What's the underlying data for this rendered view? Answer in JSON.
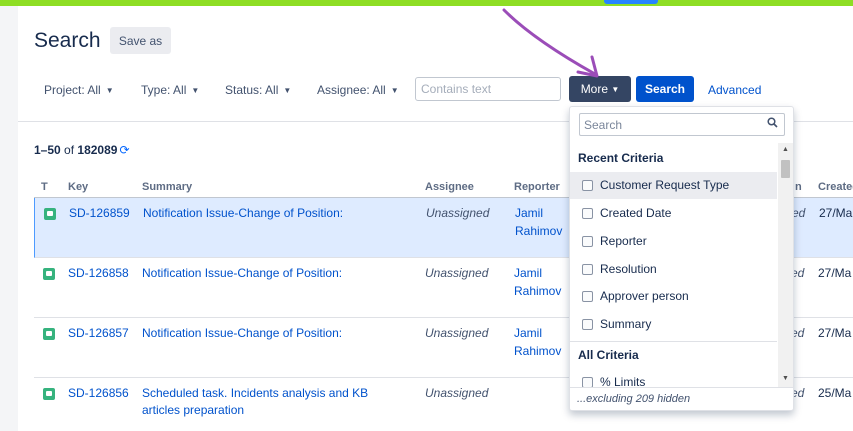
{
  "page": {
    "title": "Search",
    "save_as_label": "Save as"
  },
  "filters": {
    "project": "Project: All",
    "type": "Type: All",
    "status": "Status: All",
    "assignee": "Assignee: All",
    "text_placeholder": "Contains text",
    "more_label": "More",
    "search_label": "Search",
    "advanced_label": "Advanced"
  },
  "results": {
    "range": "1–50",
    "of_label": "of",
    "total": "182089"
  },
  "columns": {
    "t": "T",
    "key": "Key",
    "summary": "Summary",
    "assignee": "Assignee",
    "reporter": "Reporter",
    "resolution_fragment": "n",
    "created_fragment": "Created"
  },
  "issues": [
    {
      "key": "SD-126859",
      "summary": "Notification Issue-Change of Position:",
      "assignee": "Unassigned",
      "reporter_first": "Jamil",
      "reporter_last": "Rahimov",
      "resolution_fragment": "ed",
      "created_fragment": "27/Ma"
    },
    {
      "key": "SD-126858",
      "summary": "Notification Issue-Change of Position:",
      "assignee": "Unassigned",
      "reporter_first": "Jamil",
      "reporter_last": "Rahimov",
      "resolution_fragment": "ed",
      "created_fragment": "27/Ma"
    },
    {
      "key": "SD-126857",
      "summary": "Notification Issue-Change of Position:",
      "assignee": "Unassigned",
      "reporter_first": "Jamil",
      "reporter_last": "Rahimov",
      "resolution_fragment": "ed",
      "created_fragment": "27/Ma"
    },
    {
      "key": "SD-126856",
      "summary_line1": "Scheduled task. Incidents analysis and KB",
      "summary_line2": "articles preparation",
      "assignee": "Unassigned",
      "resolution_fragment": "ed",
      "created_fragment": "25/Ma"
    }
  ],
  "more_dropdown": {
    "search_placeholder": "Search",
    "recent_heading": "Recent Criteria",
    "recent_items": [
      "Customer Request Type",
      "Created Date",
      "Reporter",
      "Resolution",
      "Approver person",
      "Summary"
    ],
    "all_heading": "All Criteria",
    "all_items": [
      "% Limits"
    ],
    "footer": "...excluding 209 hidden"
  },
  "icons": {
    "issue_type": "service-request-icon",
    "refresh": "refresh-icon",
    "search": "magnifier-icon"
  },
  "colors": {
    "top_bar": "#8ede24",
    "primary": "#0052cc",
    "more_button": "#344563",
    "selected_row": "#deebff",
    "issue_type_green": "#36b37e",
    "annotation_arrow": "#9b4db8"
  }
}
